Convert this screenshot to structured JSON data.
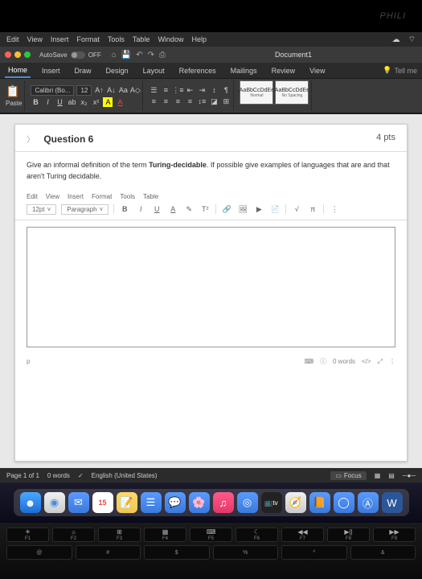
{
  "bezel_brand": "PHILI",
  "mac_menu": [
    "Edit",
    "View",
    "Insert",
    "Format",
    "Tools",
    "Table",
    "Window",
    "Help"
  ],
  "titlebar": {
    "autosave_label": "AutoSave",
    "autosave_state": "OFF",
    "doc_title": "Document1"
  },
  "ribbon_tabs": [
    "Home",
    "Insert",
    "Draw",
    "Design",
    "Layout",
    "References",
    "Mailings",
    "Review",
    "View"
  ],
  "tellme": "Tell me",
  "ribbon": {
    "paste": "Paste",
    "font_name": "Calibri (Bo...",
    "font_size": "12",
    "styles": [
      {
        "preview": "AaBbCcDdEe",
        "label": "Normal"
      },
      {
        "preview": "AaBbCcDdEe",
        "label": "No Spacing"
      }
    ]
  },
  "question": {
    "number": "Question 6",
    "points": "4 pts",
    "prompt_pre": "Give an informal definition of the term ",
    "prompt_bold": "Turing-decidable",
    "prompt_post": ". If possible give examples of languages that are and that aren't Turing decidable."
  },
  "embed": {
    "menu": [
      "Edit",
      "View",
      "Insert",
      "Format",
      "Tools",
      "Table"
    ],
    "font_size": "12pt",
    "style": "Paragraph",
    "path": "p",
    "words": "0 words"
  },
  "statusbar": {
    "page": "Page 1 of 1",
    "words": "0 words",
    "lang": "English (United States)",
    "focus": "Focus"
  },
  "calendar_day": "15",
  "fn_keys": [
    {
      "sym": "☀",
      "lbl": "F1"
    },
    {
      "sym": "☼",
      "lbl": "F2"
    },
    {
      "sym": "⊞",
      "lbl": "F3"
    },
    {
      "sym": "▦",
      "lbl": "F4"
    },
    {
      "sym": "⌨",
      "lbl": "F5"
    },
    {
      "sym": "☾",
      "lbl": "F6"
    },
    {
      "sym": "◀◀",
      "lbl": "F7"
    },
    {
      "sym": "▶||",
      "lbl": "F8"
    },
    {
      "sym": "▶▶",
      "lbl": "F9"
    }
  ],
  "num_keys": [
    "@",
    "#",
    "$",
    "%",
    "^",
    "&"
  ]
}
